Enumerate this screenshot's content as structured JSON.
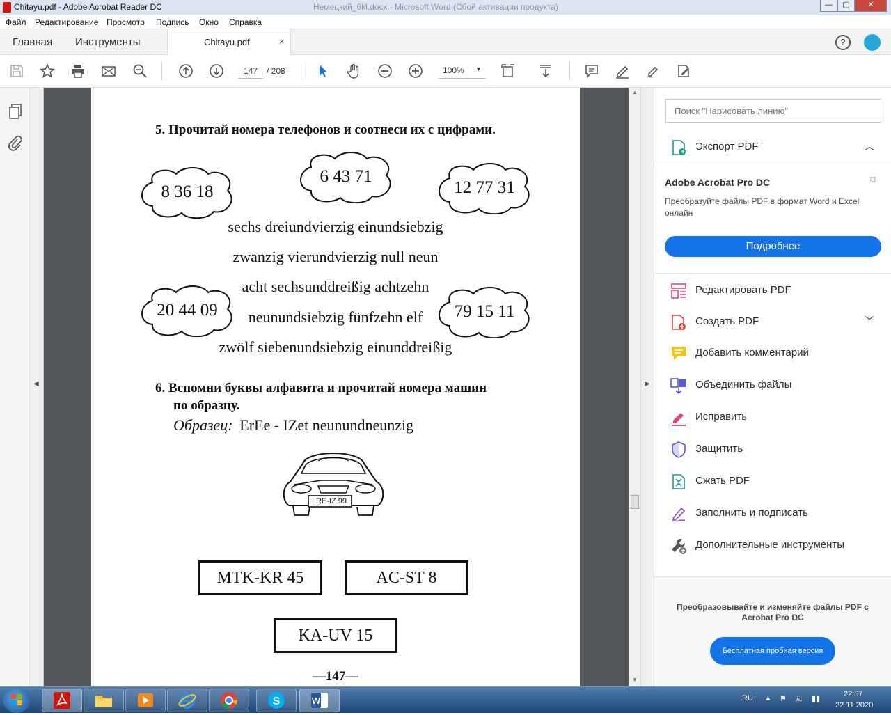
{
  "window": {
    "title": "Chitayu.pdf - Adobe Acrobat Reader DC",
    "background_title": "Немецкий_6kl.docx - Microsoft Word (Сбой активации продукта)",
    "controls": [
      "—",
      "▢",
      "✕"
    ]
  },
  "menu": [
    "Файл",
    "Редактирование",
    "Просмотр",
    "Подпись",
    "Окно",
    "Справка"
  ],
  "tabs": {
    "home": "Главная",
    "tools": "Инструменты",
    "doc": "Chitayu.pdf",
    "close": "×"
  },
  "toolbar": {
    "page_current": "147",
    "page_total": "/ 208",
    "zoom": "100%"
  },
  "page": {
    "ex5_title": "5.  Прочитай номера телефонов и соотнеси их с цифрами.",
    "clouds": [
      "8 36 18",
      "6 43 71",
      "12 77 31",
      "20 44 09",
      "79 15 11"
    ],
    "lines": [
      "sechs dreiundvierzig einundsiebzig",
      "zwanzig vierundvierzig null neun",
      "acht sechsunddreißig achtzehn",
      "neunundsiebzig fünfzehn elf",
      "zwölf siebenundsiebzig einunddreißig"
    ],
    "ex6_line1": "6.  Вспомни буквы алфавита и прочитай номера машин",
    "ex6_line2": "по образцу.",
    "sample_label": "Образец:",
    "sample_text": "ErEe - IZet neunundneunzig",
    "car_plate": "RE-IZ 99",
    "plates": [
      "MTK-KR 45",
      "AC-ST 8",
      "KA-UV 15"
    ],
    "page_number": "—147—"
  },
  "rightpanel": {
    "search_placeholder": "Поиск \"Нарисовать линию\"",
    "export_label": "Экспорт PDF",
    "promo_title": "Adobe Acrobat Pro DC",
    "promo_text": "Преобразуйте файлы PDF в формат Word и Excel онлайн",
    "promo_button": "Подробнее",
    "tools": [
      "Редактировать PDF",
      "Создать PDF",
      "Добавить комментарий",
      "Объединить файлы",
      "Исправить",
      "Защитить",
      "Сжать PDF",
      "Заполнить и подписать",
      "Дополнительные инструменты"
    ],
    "bottom_text": "Преобразовывайте и изменяйте файлы PDF с Acrobat Pro DC",
    "trial_button": "Бесплатная пробная версия"
  },
  "taskbar": {
    "lang": "RU",
    "time": "22:57",
    "date": "22.11.2020"
  },
  "colors": {
    "accent": "#1473e6",
    "pdf_red": "#d0150e"
  }
}
